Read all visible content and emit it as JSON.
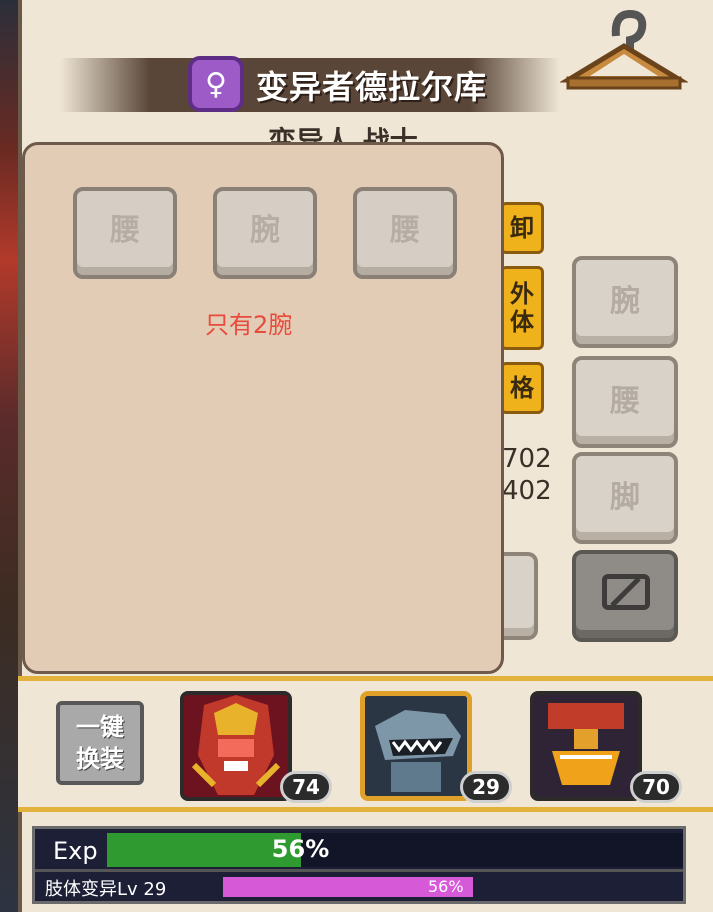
{
  "hero": {
    "name": "变异者德拉尔库",
    "gender_symbol": "♀",
    "subtitle": "变异人 战士"
  },
  "icons": {
    "hanger": "hanger-icon",
    "hidden": "hide-icon"
  },
  "side_slots": [
    {
      "label": "腕"
    },
    {
      "label": "腰"
    },
    {
      "label": "脚"
    }
  ],
  "tabs": {
    "unequip_partial": "卸",
    "appearance_partial": "外\n体",
    "personality_partial": "格"
  },
  "stats": [
    "702",
    "402"
  ],
  "overlay": {
    "slots": [
      {
        "label": "腰"
      },
      {
        "label": "腕"
      },
      {
        "label": "腰"
      }
    ],
    "note": "只有2腕"
  },
  "bottom": {
    "quick_equip_label": "一键\n换装",
    "characters": [
      {
        "level": "74",
        "selected": false
      },
      {
        "level": "29",
        "selected": true
      },
      {
        "level": "70",
        "selected": false
      }
    ]
  },
  "exp": {
    "label": "Exp",
    "percent_text": "56%",
    "percent": 56
  },
  "mutation": {
    "label": "肢体变异Lv 29",
    "percent_text": "56%",
    "percent": 56
  },
  "colors": {
    "accent_gold": "#f0b21a",
    "exp_green": "#2f9a2f",
    "mutation_pink": "#d65ad8",
    "badge_purple": "#9c5bc7",
    "note_red": "#e84a3c"
  }
}
